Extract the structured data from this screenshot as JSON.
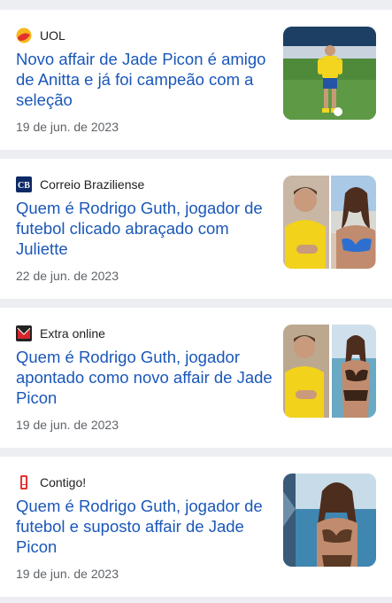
{
  "articles": [
    {
      "source": "UOL",
      "logo_icon": "uol-logo-icon",
      "headline": "Novo affair de Jade Picon é amigo de Anitta e já foi campeão com a seleção",
      "date": "19 de jun. de 2023",
      "thumbnail": "soccer-player-thumbnail"
    },
    {
      "source": "Correio Braziliense",
      "logo_icon": "correio-braziliense-logo-icon",
      "logo_text": "CB",
      "headline": "Quem é Rodrigo Guth, jogador de futebol clicado abraçado com Juliette",
      "date": "22 de jun. de 2023",
      "thumbnail": "couple-collage-thumbnail"
    },
    {
      "source": "Extra online",
      "logo_icon": "extra-online-logo-icon",
      "headline": "Quem é Rodrigo Guth, jogador apontado como novo affair de Jade Picon",
      "date": "19 de jun. de 2023",
      "thumbnail": "couple-collage-beach-thumbnail"
    },
    {
      "source": "Contigo!",
      "logo_icon": "contigo-logo-icon",
      "headline": "Quem é Rodrigo Guth, jogador de futebol e suposto affair de Jade Picon",
      "date": "19 de jun. de 2023",
      "thumbnail": "woman-beach-thumbnail"
    }
  ],
  "colors": {
    "headline": "#1a57b9",
    "background": "#eceef2",
    "card": "#ffffff"
  }
}
